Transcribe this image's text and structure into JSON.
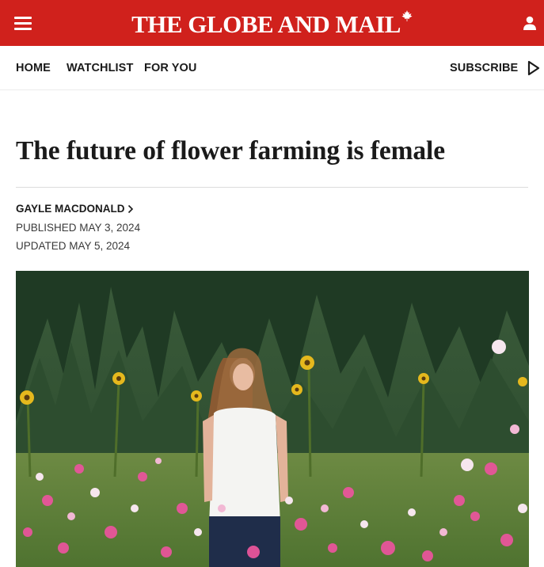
{
  "header": {
    "brand": "THE GLOBE AND MAIL",
    "brand_color": "#d0211c",
    "menu_icon": "hamburger-menu-icon",
    "account_icon": "user-icon",
    "brand_icon": "maple-leaf-icon"
  },
  "nav": {
    "items": [
      {
        "label": "HOME"
      },
      {
        "label": "WATCHLIST"
      },
      {
        "label": "FOR YOU"
      }
    ],
    "subscribe_label": "SUBSCRIBE",
    "play_icon": "play-icon"
  },
  "article": {
    "headline": "The future of flower farming is female",
    "author": "GAYLE MACDONALD",
    "published": "PUBLISHED MAY 3, 2024",
    "updated": "UPDATED MAY 5, 2024"
  },
  "photo": {
    "subject": "woman-standing-in-flower-field"
  }
}
